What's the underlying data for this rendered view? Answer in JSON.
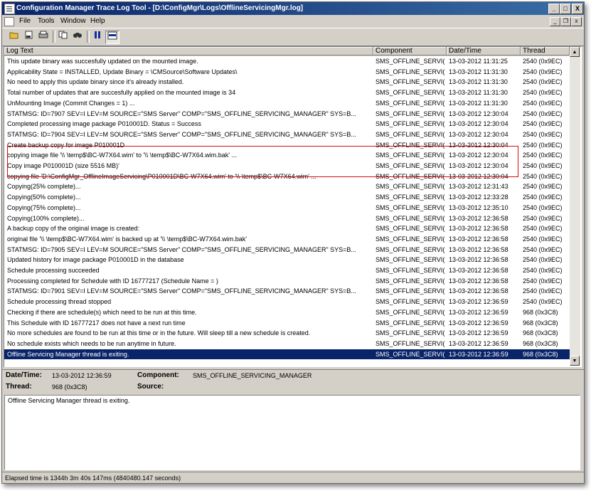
{
  "window": {
    "title": "Configuration Manager Trace Log Tool - [D:\\ConfigMgr\\Logs\\OfflineServicingMgr.log]",
    "minimize_glyph": "_",
    "maximize_glyph": "□",
    "close_glyph": "X"
  },
  "menu": {
    "items": [
      "File",
      "Tools",
      "Window",
      "Help"
    ],
    "child_minimize": "_",
    "child_restore": "❐",
    "child_close": "x"
  },
  "toolbar": {
    "icons": [
      "open-folder-icon",
      "print-preview-icon",
      "print-icon",
      "copy-icon",
      "find-icon",
      "pause-icon",
      "highlight-view-icon"
    ]
  },
  "columns": [
    "Log Text",
    "Component",
    "Date/Time",
    "Thread"
  ],
  "rows": [
    {
      "text": "This update binary was succesfully updated on the mounted image.",
      "component": "SMS_OFFLINE_SERVI(",
      "datetime": "13-03-2012 11:31:25",
      "thread": "2540 (0x9EC)"
    },
    {
      "text": "Applicability State = INSTALLED, Update Binary =                                                     \\CMSource\\Software Updates\\",
      "component": "SMS_OFFLINE_SERVI(",
      "datetime": "13-03-2012 11:31:30",
      "thread": "2540 (0x9EC)"
    },
    {
      "text": "No need to apply this update binary since it's already installed.",
      "component": "SMS_OFFLINE_SERVI(",
      "datetime": "13-03-2012 11:31:30",
      "thread": "2540 (0x9EC)"
    },
    {
      "text": "Total number of updates that are succesfully applied on the mounted image is 34",
      "component": "SMS_OFFLINE_SERVI(",
      "datetime": "13-03-2012 11:31:30",
      "thread": "2540 (0x9EC)"
    },
    {
      "text": "UnMounting Image (Commit Changes = 1) ...",
      "component": "SMS_OFFLINE_SERVI(",
      "datetime": "13-03-2012 11:31:30",
      "thread": "2540 (0x9EC)"
    },
    {
      "text": "STATMSG: ID=7907 SEV=I LEV=M SOURCE=\"SMS Server\" COMP=\"SMS_OFFLINE_SERVICING_MANAGER\" SYS=B...",
      "component": "SMS_OFFLINE_SERVI(",
      "datetime": "13-03-2012 12:30:04",
      "thread": "2540 (0x9EC)"
    },
    {
      "text": "Completed processing image package P010001D. Status = Success",
      "component": "SMS_OFFLINE_SERVI(",
      "datetime": "13-03-2012 12:30:04",
      "thread": "2540 (0x9EC)"
    },
    {
      "text": "STATMSG: ID=7904 SEV=I LEV=M SOURCE=\"SMS Server\" COMP=\"SMS_OFFLINE_SERVICING_MANAGER\" SYS=B...",
      "component": "SMS_OFFLINE_SERVI(",
      "datetime": "13-03-2012 12:30:04",
      "thread": "2540 (0x9EC)"
    },
    {
      "text": "Create backup copy for image P010001D",
      "component": "SMS_OFFLINE_SERVI(",
      "datetime": "13-03-2012 12:30:04",
      "thread": "2540 (0x9EC)"
    },
    {
      "text": "copying image file '\\\\            \\temp$\\BC-W7X64.wim' to '\\\\            \\temp$\\BC-W7X64.wim.bak' ...",
      "component": "SMS_OFFLINE_SERVI(",
      "datetime": "13-03-2012 12:30:04",
      "thread": "2540 (0x9EC)"
    },
    {
      "text": "Copy image P010001D (size 5516 MB)'",
      "component": "SMS_OFFLINE_SERVI(",
      "datetime": "13-03-2012 12:30:04",
      "thread": "2540 (0x9EC)"
    },
    {
      "text": "copying file 'D:\\ConfigMgr_OfflineImageServicing\\P010001D\\BC-W7X64.wim' to '\\\\            \\temp$\\BC-W7X64.wim' ...",
      "component": "SMS_OFFLINE_SERVI(",
      "datetime": "13-03-2012 12:30:04",
      "thread": "2540 (0x9EC)"
    },
    {
      "text": "Copying(25% complete)...",
      "component": "SMS_OFFLINE_SERVI(",
      "datetime": "13-03-2012 12:31:43",
      "thread": "2540 (0x9EC)"
    },
    {
      "text": "Copying(50% complete)...",
      "component": "SMS_OFFLINE_SERVI(",
      "datetime": "13-03-2012 12:33:28",
      "thread": "2540 (0x9EC)"
    },
    {
      "text": "Copying(75% complete)...",
      "component": "SMS_OFFLINE_SERVI(",
      "datetime": "13-03-2012 12:35:10",
      "thread": "2540 (0x9EC)"
    },
    {
      "text": "Copying(100% complete)...",
      "component": "SMS_OFFLINE_SERVI(",
      "datetime": "13-03-2012 12:36:58",
      "thread": "2540 (0x9EC)"
    },
    {
      "text": "A backup copy of the original image is created:",
      "component": "SMS_OFFLINE_SERVI(",
      "datetime": "13-03-2012 12:36:58",
      "thread": "2540 (0x9EC)"
    },
    {
      "text": "original file '\\\\            \\temp$\\BC-W7X64.wim' is backed up at '\\\\            \\temp$\\BC-W7X64.wim.bak'",
      "component": "SMS_OFFLINE_SERVI(",
      "datetime": "13-03-2012 12:36:58",
      "thread": "2540 (0x9EC)"
    },
    {
      "text": "STATMSG: ID=7905 SEV=I LEV=M SOURCE=\"SMS Server\" COMP=\"SMS_OFFLINE_SERVICING_MANAGER\" SYS=B...",
      "component": "SMS_OFFLINE_SERVI(",
      "datetime": "13-03-2012 12:36:58",
      "thread": "2540 (0x9EC)"
    },
    {
      "text": "Updated history for image package P010001D in the database",
      "component": "SMS_OFFLINE_SERVI(",
      "datetime": "13-03-2012 12:36:58",
      "thread": "2540 (0x9EC)"
    },
    {
      "text": "Schedule processing succeeded",
      "component": "SMS_OFFLINE_SERVI(",
      "datetime": "13-03-2012 12:36:58",
      "thread": "2540 (0x9EC)"
    },
    {
      "text": "Processing completed for Schedule with ID 16777217 (Schedule Name = )",
      "component": "SMS_OFFLINE_SERVI(",
      "datetime": "13-03-2012 12:36:58",
      "thread": "2540 (0x9EC)"
    },
    {
      "text": "STATMSG: ID=7901 SEV=I LEV=M SOURCE=\"SMS Server\" COMP=\"SMS_OFFLINE_SERVICING_MANAGER\" SYS=B...",
      "component": "SMS_OFFLINE_SERVI(",
      "datetime": "13-03-2012 12:36:58",
      "thread": "2540 (0x9EC)"
    },
    {
      "text": "Schedule processing thread stopped",
      "component": "SMS_OFFLINE_SERVI(",
      "datetime": "13-03-2012 12:36:59",
      "thread": "2540 (0x9EC)"
    },
    {
      "text": "Checking if there are schedule(s) which need to be run at this time.",
      "component": "SMS_OFFLINE_SERVI(",
      "datetime": "13-03-2012 12:36:59",
      "thread": "968 (0x3C8)"
    },
    {
      "text": "This Schedule with ID 16777217 does not have a next run time",
      "component": "SMS_OFFLINE_SERVI(",
      "datetime": "13-03-2012 12:36:59",
      "thread": "968 (0x3C8)"
    },
    {
      "text": "No more schedules are found to be run at this time or in the future. Will sleep till a new schedule is created.",
      "component": "SMS_OFFLINE_SERVI(",
      "datetime": "13-03-2012 12:36:59",
      "thread": "968 (0x3C8)"
    },
    {
      "text": "No schedule exists which needs to be run anytime in future.",
      "component": "SMS_OFFLINE_SERVI(",
      "datetime": "13-03-2012 12:36:59",
      "thread": "968 (0x3C8)"
    },
    {
      "text": "Offline Servicing Manager thread is exiting.",
      "component": "SMS_OFFLINE_SERVI(",
      "datetime": "13-03-2012 12:36:59",
      "thread": "968 (0x3C8)"
    }
  ],
  "selected_row": 28,
  "highlighted_rows": [
    4,
    5,
    6
  ],
  "colors": {
    "selection": "#0a246a",
    "highlight_box": "#d01010",
    "title_bar": "#0a246a"
  },
  "details": {
    "datetime_label": "Date/Time:",
    "datetime_value": "13-03-2012 12:36:59",
    "component_label": "Component:",
    "component_value": "SMS_OFFLINE_SERVICING_MANAGER",
    "thread_label": "Thread:",
    "thread_value": "968 (0x3C8)",
    "source_label": "Source:",
    "source_value": "",
    "message": "Offline Servicing Manager thread is exiting."
  },
  "status_bar": "Elapsed time is 1344h 3m 40s 147ms (4840480.147 seconds)"
}
